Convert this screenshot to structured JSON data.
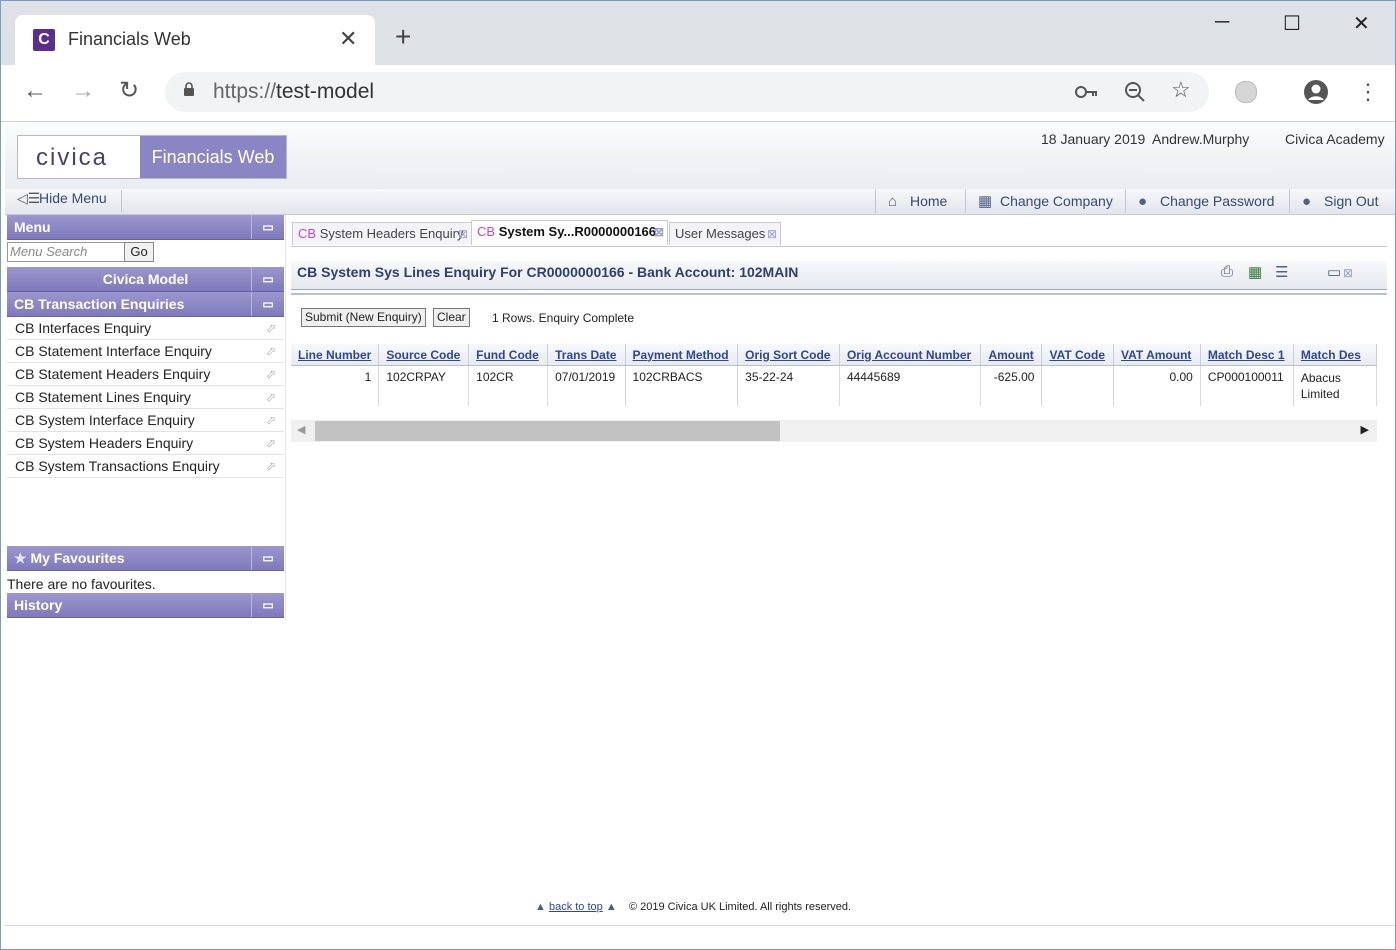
{
  "browser": {
    "tab_title": "Financials Web",
    "favicon_letter": "C",
    "tab_close": "✕",
    "new_tab": "+",
    "url_scheme": "https://",
    "url_host": "test-model",
    "window_controls": {
      "minimize": "─",
      "maximize": "☐",
      "close": "✕"
    }
  },
  "app": {
    "logo_text": "civica",
    "product": "Financials Web",
    "date": "18 January 2019",
    "user": "Andrew.Murphy",
    "company": "Civica Academy"
  },
  "toolbar": {
    "hide_menu": "Hide Menu",
    "home": "Home",
    "change_company": "Change Company",
    "change_password": "Change Password",
    "sign_out": "Sign Out"
  },
  "menu": {
    "title": "Menu",
    "search_placeholder": "Menu Search",
    "go": "Go",
    "model": "Civica Model",
    "section": "CB Transaction Enquiries",
    "items": [
      "CB Interfaces Enquiry",
      "CB Statement Interface Enquiry",
      "CB Statement Headers Enquiry",
      "CB Statement Lines Enquiry",
      "CB System Interface Enquiry",
      "CB System Headers Enquiry",
      "CB System Transactions Enquiry"
    ],
    "favourites_title": "My Favourites",
    "no_favourites": "There are no favourites.",
    "history_title": "History"
  },
  "tabs": [
    {
      "prefix": "CB",
      "label": "System Headers Enquiry"
    },
    {
      "prefix": "CB",
      "label": "System Sy...R0000000166"
    },
    {
      "prefix": "",
      "label": "User Messages"
    }
  ],
  "panel": {
    "title": "CB System Sys Lines Enquiry For CR0000000166 - Bank Account: 102MAIN",
    "submit": "Submit (New Enquiry)",
    "clear": "Clear",
    "status": "1 Rows. Enquiry Complete"
  },
  "table": {
    "headers": [
      "Line Number",
      "Source Code",
      "Fund Code",
      "Trans Date",
      "Payment Method",
      "Orig Sort Code",
      "Orig Account Number",
      "Amount",
      "VAT Code",
      "VAT Amount",
      "Match Desc 1",
      "Match Des"
    ],
    "row": {
      "line_number": "1",
      "source_code": "102CRPAY",
      "fund_code": "102CR",
      "trans_date": "07/01/2019",
      "payment_method": "102CRBACS",
      "orig_sort_code": "35-22-24",
      "orig_account_number": "44445689",
      "amount": "-625.00",
      "vat_code": "",
      "vat_amount": "0.00",
      "match_desc_1": "CP000100011",
      "match_desc_2_line1": "Abacus",
      "match_desc_2_line2": "Limited"
    }
  },
  "footer": {
    "back_to_top": "back to top",
    "copyright": "© 2019 Civica UK Limited. All rights reserved."
  }
}
